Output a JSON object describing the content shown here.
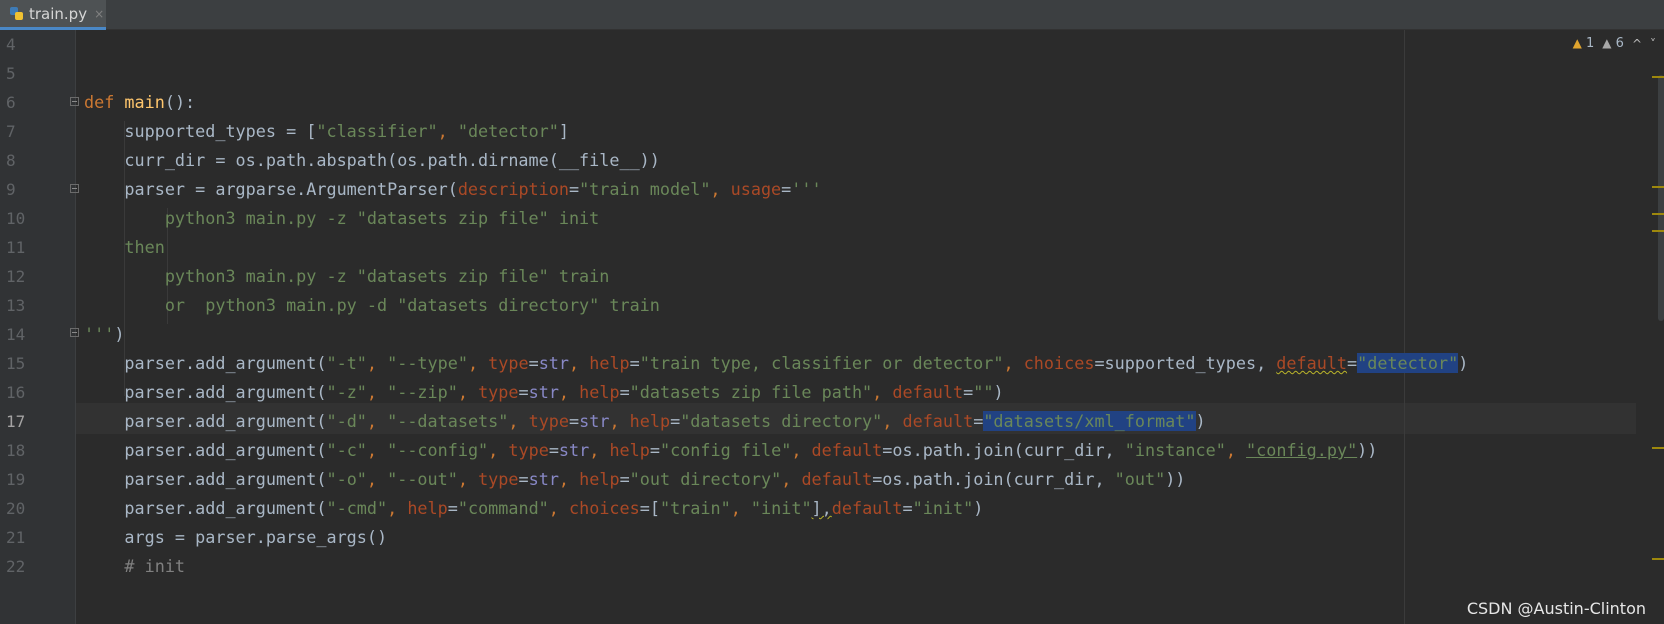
{
  "tab": {
    "filename": "train.py",
    "close": "×",
    "icon": "python-file-icon"
  },
  "inspections": {
    "warnings": "1",
    "weak_warnings": "6",
    "up": "^",
    "down": "˅"
  },
  "line_numbers": [
    "4",
    "5",
    "6",
    "7",
    "8",
    "9",
    "10",
    "11",
    "12",
    "13",
    "14",
    "15",
    "16",
    "17",
    "18",
    "19",
    "20",
    "21",
    "22"
  ],
  "current_line": "17",
  "code": {
    "l4": "",
    "l5": "",
    "l6": {
      "kw": "def",
      "name": "main",
      "rest": "():"
    },
    "l7": {
      "a": "    supported_types = [",
      "s1": "\"classifier\"",
      "c": ", ",
      "s2": "\"detector\"",
      "e": "]"
    },
    "l8": {
      "a": "    curr_dir = os.path.abspath(os.path.dirname(__file__))"
    },
    "l9": {
      "a": "    parser = argparse.ArgumentParser(",
      "p1": "description",
      "eq1": "=",
      "s1": "\"train model\"",
      "c": ", ",
      "p2": "usage",
      "eq2": "=",
      "s2": "'''"
    },
    "l10": "        python3 main.py -z \"datasets zip file\" init",
    "l11": "    then",
    "l12": "        python3 main.py -z \"datasets zip file\" train",
    "l13": "        or  python3 main.py -d \"datasets directory\" train",
    "l14": {
      "s": "'''",
      "e": ")"
    },
    "l15": {
      "a": "    parser.add_argument(",
      "s1": "\"-t\"",
      "c1": ", ",
      "s2": "\"--type\"",
      "c2": ", ",
      "p1": "type",
      "eq1": "=",
      "b1": "str",
      "c3": ", ",
      "p2": "help",
      "eq2": "=",
      "s3": "\"train type, classifier or detector\"",
      "c4": ", ",
      "p3": "choices",
      "eq3": "=supported_types, ",
      "p4": "default",
      "eq4": "=",
      "s4": "\"detector\"",
      "e": ")"
    },
    "l16": {
      "a": "    parser.add_argument(",
      "s1": "\"-z\"",
      "c1": ", ",
      "s2": "\"--zip\"",
      "c2": ", ",
      "p1": "type",
      "eq1": "=",
      "b1": "str",
      "c3": ", ",
      "p2": "help",
      "eq2": "=",
      "s3": "\"datasets zip file path\"",
      "c4": ", ",
      "p3": "default",
      "eq3": "=",
      "s4": "\"\"",
      "e": ")"
    },
    "l17": {
      "a": "    parser.add_argument(",
      "s1": "\"-d\"",
      "c1": ", ",
      "s2": "\"--datasets\"",
      "c2": ", ",
      "p1": "type",
      "eq1": "=",
      "b1": "str",
      "c3": ", ",
      "p2": "help",
      "eq2": "=",
      "s3": "\"datasets directory\"",
      "c4": ", ",
      "p3": "default",
      "eq3": "=",
      "s4": "\"datasets/xml_format\"",
      "e": ")"
    },
    "l18": {
      "a": "    parser.add_argument(",
      "s1": "\"-c\"",
      "c1": ", ",
      "s2": "\"--config\"",
      "c2": ", ",
      "p1": "type",
      "eq1": "=",
      "b1": "str",
      "c3": ", ",
      "p2": "help",
      "eq2": "=",
      "s3": "\"config file\"",
      "c4": ", ",
      "p3": "default",
      "eq3": "=os.path.join(curr_dir, ",
      "s4": "\"instance\"",
      "c5": ", ",
      "s5": "\"config.py\"",
      "e": "))"
    },
    "l19": {
      "a": "    parser.add_argument(",
      "s1": "\"-o\"",
      "c1": ", ",
      "s2": "\"--out\"",
      "c2": ", ",
      "p1": "type",
      "eq1": "=",
      "b1": "str",
      "c3": ", ",
      "p2": "help",
      "eq2": "=",
      "s3": "\"out directory\"",
      "c4": ", ",
      "p3": "default",
      "eq3": "=os.path.join(curr_dir, ",
      "s4": "\"out\"",
      "e": "))"
    },
    "l20": {
      "a": "    parser.add_argument(",
      "s1": "\"-cmd\"",
      "c1": ", ",
      "p1": "help",
      "eq1": "=",
      "s2": "\"command\"",
      "c2": ", ",
      "p2": "choices",
      "eq2": "=[",
      "s3": "\"train\"",
      "c3": ", ",
      "s4": "\"init\"",
      "c4": "],",
      "p3": "default",
      "eq3": "=",
      "s5": "\"init\"",
      "e": ")"
    },
    "l21": "    args = parser.parse_args()",
    "l22": "    # init"
  },
  "watermark": "CSDN @Austin-Clinton",
  "colors": {
    "keyword": "#cc7832",
    "function": "#ffc66d",
    "string": "#6a8759",
    "param": "#aa4926",
    "builtin": "#8888c6",
    "selection": "#214283"
  }
}
